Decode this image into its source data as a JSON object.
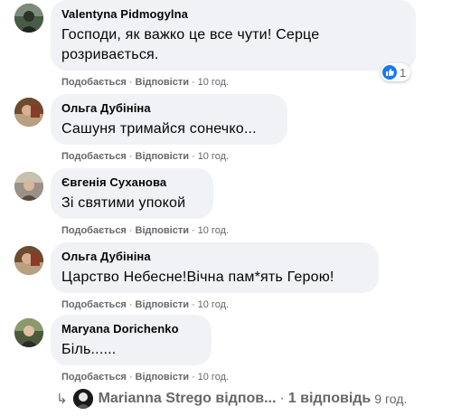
{
  "comments": [
    {
      "author": "Valentyna Pidmogylna",
      "text_line1": "Господи, як важко це все чути! Серце",
      "text_line2": "розривається.",
      "like_label": "Подобається",
      "reply_label": "Відповісти",
      "time": "10 год.",
      "reaction_count": "1",
      "avatar_icon": "profile-photo-icon"
    },
    {
      "author": "Ольга Дубініна",
      "text": "Сашуня тримайся сонечко...",
      "like_label": "Подобається",
      "reply_label": "Відповісти",
      "time": "10 год.",
      "avatar_icon": "profile-photo-icon"
    },
    {
      "author": "Євгенія Суханова",
      "text": "Зі святими упокой",
      "like_label": "Подобається",
      "reply_label": "Відповісти",
      "time": "10 год.",
      "avatar_icon": "profile-photo-icon"
    },
    {
      "author": "Ольга Дубініна",
      "text": "Царство Небесне!Вічна пам*ять Герою!",
      "like_label": "Подобається",
      "reply_label": "Відповісти",
      "time": "10 год.",
      "avatar_icon": "profile-photo-icon"
    },
    {
      "author": "Maryana Dorichenko",
      "text": "Біль......",
      "like_label": "Подобається",
      "reply_label": "Відповісти",
      "time": "10 год.",
      "avatar_icon": "profile-photo-icon"
    }
  ],
  "reply_thread": {
    "author_preview": "Marianna Strego відпов...",
    "separator": "·",
    "count_label": "1 відповідь",
    "time": "9 год."
  },
  "colors": {
    "bubble_bg": "#f0f2f5",
    "secondary_text": "#65676b",
    "like_blue": "#1877f2"
  }
}
